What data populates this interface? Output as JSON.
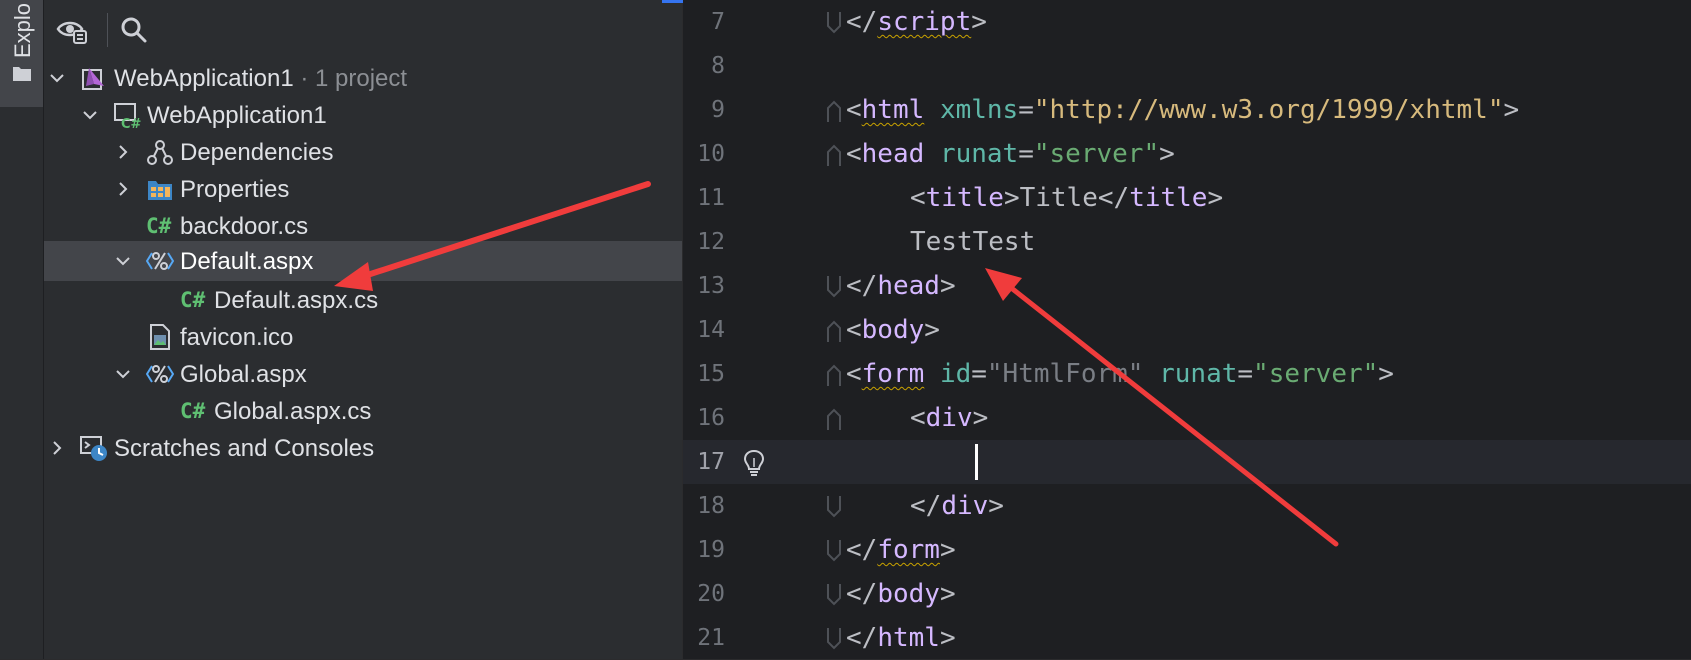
{
  "colors": {
    "accent": "#3574f0",
    "arrow": "#f03c3c",
    "tag": "#d5b8ff",
    "attribute": "#5fb7a8",
    "string": "#6aab73",
    "csharp_icon": "#5fbf72"
  },
  "side_strip": {
    "label": "Explorer",
    "icon": "folder-icon"
  },
  "toolbar": {
    "icons": [
      "eye-settings-icon",
      "search-icon"
    ]
  },
  "tree": {
    "rows": [
      {
        "label": "WebApplication1",
        "hint": "· 1 project",
        "icon": "solution-icon",
        "expanded": true,
        "depth": 0
      },
      {
        "label": "WebApplication1",
        "hint": "",
        "icon": "csharp-project-icon",
        "expanded": true,
        "depth": 1
      },
      {
        "label": "Dependencies",
        "hint": "",
        "icon": "dependencies-icon",
        "expanded": false,
        "depth": 2
      },
      {
        "label": "Properties",
        "hint": "",
        "icon": "properties-folder-icon",
        "expanded": false,
        "depth": 2
      },
      {
        "label": "backdoor.cs",
        "hint": "",
        "icon": "csharp-file-icon",
        "icon_text": "C#",
        "depth": 2
      },
      {
        "label": "Default.aspx",
        "hint": "",
        "icon": "aspx-file-icon",
        "expanded": true,
        "selected": true,
        "depth": 2
      },
      {
        "label": "Default.aspx.cs",
        "hint": "",
        "icon": "csharp-file-icon",
        "icon_text": "C#",
        "depth": 3
      },
      {
        "label": "favicon.ico",
        "hint": "",
        "icon": "image-file-icon",
        "depth": 2
      },
      {
        "label": "Global.aspx",
        "hint": "",
        "icon": "aspx-file-icon",
        "expanded": true,
        "depth": 2
      },
      {
        "label": "Global.aspx.cs",
        "hint": "",
        "icon": "csharp-file-icon",
        "icon_text": "C#",
        "depth": 3
      },
      {
        "label": "Scratches and Consoles",
        "hint": "",
        "icon": "scratches-icon",
        "expanded": false,
        "depth": 0
      }
    ]
  },
  "editor": {
    "current_line": "17",
    "lines": [
      {
        "n": "7",
        "p1": "</",
        "t1": "script",
        "p2": ">"
      },
      {
        "n": "8"
      },
      {
        "n": "9",
        "p1": "<",
        "t1": "html",
        "a1": "xmlns",
        "e1": "=",
        "s1": "\"http://www.w3.org/1999/xhtml\"",
        "p2": ">"
      },
      {
        "n": "10",
        "p1": "<",
        "t1": "head",
        "a1": "runat",
        "e1": "=",
        "s1": "\"server\"",
        "p2": ">"
      },
      {
        "n": "11",
        "p1": "<",
        "t1": "title",
        "p2": ">",
        "txt": "Title",
        "p3": "</",
        "t2": "title",
        "p4": ">"
      },
      {
        "n": "12",
        "txt": "TestTest"
      },
      {
        "n": "13",
        "p1": "</",
        "t1": "head",
        "p2": ">"
      },
      {
        "n": "14",
        "p1": "<",
        "t1": "body",
        "p2": ">"
      },
      {
        "n": "15",
        "p1": "<",
        "t1": "form",
        "a1": "id",
        "e1": "=",
        "s1": "\"HtmlForm\"",
        "a2": "runat",
        "e2": "=",
        "s2": "\"server\"",
        "p2": ">"
      },
      {
        "n": "16",
        "p1": "<",
        "t1": "div",
        "p2": ">"
      },
      {
        "n": "17"
      },
      {
        "n": "18",
        "p1": "</",
        "t1": "div",
        "p2": ">"
      },
      {
        "n": "19",
        "p1": "</",
        "t1": "form",
        "p2": ">"
      },
      {
        "n": "20",
        "p1": "</",
        "t1": "body",
        "p2": ">"
      },
      {
        "n": "21",
        "p1": "</",
        "t1": "html",
        "p2": ">"
      }
    ]
  },
  "annotations": {
    "arrows": [
      "arrow-to-default-aspx",
      "arrow-to-testtest"
    ]
  }
}
